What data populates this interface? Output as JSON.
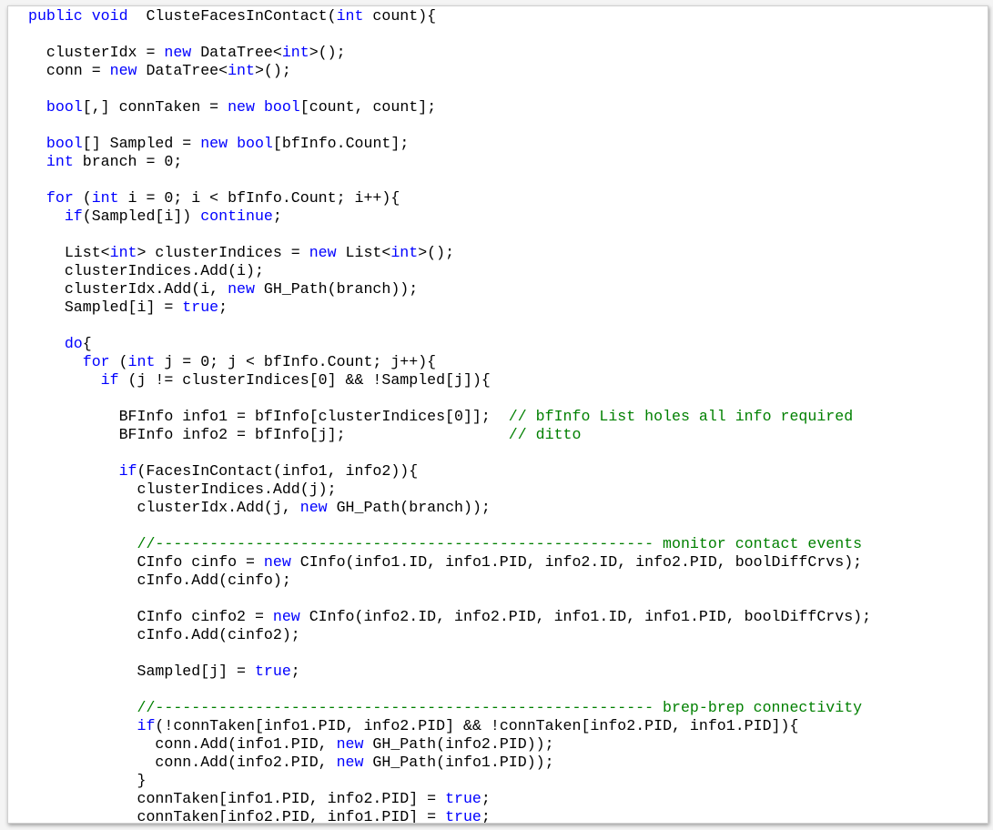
{
  "colors": {
    "keyword": "#0000ff",
    "comment": "#008000",
    "text": "#000000",
    "background": "#ffffff"
  },
  "code_lines": [
    [
      {
        "t": "public void",
        "c": "kw"
      },
      {
        "t": "  ClusteFacesInContact(",
        "c": "pl"
      },
      {
        "t": "int",
        "c": "kw"
      },
      {
        "t": " count){",
        "c": "pl"
      }
    ],
    [],
    [
      {
        "t": "  clusterIdx = ",
        "c": "pl"
      },
      {
        "t": "new",
        "c": "kw"
      },
      {
        "t": " DataTree<",
        "c": "pl"
      },
      {
        "t": "int",
        "c": "kw"
      },
      {
        "t": ">();",
        "c": "pl"
      }
    ],
    [
      {
        "t": "  conn = ",
        "c": "pl"
      },
      {
        "t": "new",
        "c": "kw"
      },
      {
        "t": " DataTree<",
        "c": "pl"
      },
      {
        "t": "int",
        "c": "kw"
      },
      {
        "t": ">();",
        "c": "pl"
      }
    ],
    [],
    [
      {
        "t": "  ",
        "c": "pl"
      },
      {
        "t": "bool",
        "c": "kw"
      },
      {
        "t": "[,] connTaken = ",
        "c": "pl"
      },
      {
        "t": "new",
        "c": "kw"
      },
      {
        "t": " ",
        "c": "pl"
      },
      {
        "t": "bool",
        "c": "kw"
      },
      {
        "t": "[count, count];",
        "c": "pl"
      }
    ],
    [],
    [
      {
        "t": "  ",
        "c": "pl"
      },
      {
        "t": "bool",
        "c": "kw"
      },
      {
        "t": "[] Sampled = ",
        "c": "pl"
      },
      {
        "t": "new",
        "c": "kw"
      },
      {
        "t": " ",
        "c": "pl"
      },
      {
        "t": "bool",
        "c": "kw"
      },
      {
        "t": "[bfInfo.Count];",
        "c": "pl"
      }
    ],
    [
      {
        "t": "  ",
        "c": "pl"
      },
      {
        "t": "int",
        "c": "kw"
      },
      {
        "t": " branch = 0;",
        "c": "pl"
      }
    ],
    [],
    [
      {
        "t": "  ",
        "c": "pl"
      },
      {
        "t": "for",
        "c": "kw"
      },
      {
        "t": " (",
        "c": "pl"
      },
      {
        "t": "int",
        "c": "kw"
      },
      {
        "t": " i = 0; i < bfInfo.Count; i++){",
        "c": "pl"
      }
    ],
    [
      {
        "t": "    ",
        "c": "pl"
      },
      {
        "t": "if",
        "c": "kw"
      },
      {
        "t": "(Sampled[i]) ",
        "c": "pl"
      },
      {
        "t": "continue",
        "c": "kw"
      },
      {
        "t": ";",
        "c": "pl"
      }
    ],
    [],
    [
      {
        "t": "    List<",
        "c": "pl"
      },
      {
        "t": "int",
        "c": "kw"
      },
      {
        "t": "> clusterIndices = ",
        "c": "pl"
      },
      {
        "t": "new",
        "c": "kw"
      },
      {
        "t": " List<",
        "c": "pl"
      },
      {
        "t": "int",
        "c": "kw"
      },
      {
        "t": ">();",
        "c": "pl"
      }
    ],
    [
      {
        "t": "    clusterIndices.Add(i);",
        "c": "pl"
      }
    ],
    [
      {
        "t": "    clusterIdx.Add(i, ",
        "c": "pl"
      },
      {
        "t": "new",
        "c": "kw"
      },
      {
        "t": " GH_Path(branch));",
        "c": "pl"
      }
    ],
    [
      {
        "t": "    Sampled[i] = ",
        "c": "pl"
      },
      {
        "t": "true",
        "c": "kw"
      },
      {
        "t": ";",
        "c": "pl"
      }
    ],
    [],
    [
      {
        "t": "    ",
        "c": "pl"
      },
      {
        "t": "do",
        "c": "kw"
      },
      {
        "t": "{",
        "c": "pl"
      }
    ],
    [
      {
        "t": "      ",
        "c": "pl"
      },
      {
        "t": "for",
        "c": "kw"
      },
      {
        "t": " (",
        "c": "pl"
      },
      {
        "t": "int",
        "c": "kw"
      },
      {
        "t": " j = 0; j < bfInfo.Count; j++){",
        "c": "pl"
      }
    ],
    [
      {
        "t": "        ",
        "c": "pl"
      },
      {
        "t": "if",
        "c": "kw"
      },
      {
        "t": " (j != clusterIndices[0] && !Sampled[j]){",
        "c": "pl"
      }
    ],
    [],
    [
      {
        "t": "          BFInfo info1 = bfInfo[clusterIndices[0]];  ",
        "c": "pl"
      },
      {
        "t": "// bfInfo List holes all info required",
        "c": "cm"
      }
    ],
    [
      {
        "t": "          BFInfo info2 = bfInfo[j];                  ",
        "c": "pl"
      },
      {
        "t": "// ditto",
        "c": "cm"
      }
    ],
    [],
    [
      {
        "t": "          ",
        "c": "pl"
      },
      {
        "t": "if",
        "c": "kw"
      },
      {
        "t": "(FacesInContact(info1, info2)){",
        "c": "pl"
      }
    ],
    [
      {
        "t": "            clusterIndices.Add(j);",
        "c": "pl"
      }
    ],
    [
      {
        "t": "            clusterIdx.Add(j, ",
        "c": "pl"
      },
      {
        "t": "new",
        "c": "kw"
      },
      {
        "t": " GH_Path(branch));",
        "c": "pl"
      }
    ],
    [],
    [
      {
        "t": "            ",
        "c": "pl"
      },
      {
        "t": "//------------------------------------------------------- monitor contact events",
        "c": "cm"
      }
    ],
    [
      {
        "t": "            CInfo cinfo = ",
        "c": "pl"
      },
      {
        "t": "new",
        "c": "kw"
      },
      {
        "t": " CInfo(info1.ID, info1.PID, info2.ID, info2.PID, boolDiffCrvs);",
        "c": "pl"
      }
    ],
    [
      {
        "t": "            cInfo.Add(cinfo);",
        "c": "pl"
      }
    ],
    [],
    [
      {
        "t": "            CInfo cinfo2 = ",
        "c": "pl"
      },
      {
        "t": "new",
        "c": "kw"
      },
      {
        "t": " CInfo(info2.ID, info2.PID, info1.ID, info1.PID, boolDiffCrvs);",
        "c": "pl"
      }
    ],
    [
      {
        "t": "            cInfo.Add(cinfo2);",
        "c": "pl"
      }
    ],
    [],
    [
      {
        "t": "            Sampled[j] = ",
        "c": "pl"
      },
      {
        "t": "true",
        "c": "kw"
      },
      {
        "t": ";",
        "c": "pl"
      }
    ],
    [],
    [
      {
        "t": "            ",
        "c": "pl"
      },
      {
        "t": "//------------------------------------------------------- brep-brep connectivity",
        "c": "cm"
      }
    ],
    [
      {
        "t": "            ",
        "c": "pl"
      },
      {
        "t": "if",
        "c": "kw"
      },
      {
        "t": "(!connTaken[info1.PID, info2.PID] && !connTaken[info2.PID, info1.PID]){",
        "c": "pl"
      }
    ],
    [
      {
        "t": "              conn.Add(info1.PID, ",
        "c": "pl"
      },
      {
        "t": "new",
        "c": "kw"
      },
      {
        "t": " GH_Path(info2.PID));",
        "c": "pl"
      }
    ],
    [
      {
        "t": "              conn.Add(info2.PID, ",
        "c": "pl"
      },
      {
        "t": "new",
        "c": "kw"
      },
      {
        "t": " GH_Path(info1.PID));",
        "c": "pl"
      }
    ],
    [
      {
        "t": "            }",
        "c": "pl"
      }
    ],
    [
      {
        "t": "            connTaken[info1.PID, info2.PID] = ",
        "c": "pl"
      },
      {
        "t": "true",
        "c": "kw"
      },
      {
        "t": ";",
        "c": "pl"
      }
    ],
    [
      {
        "t": "            connTaken[info2.PID, info1.PID] = ",
        "c": "pl"
      },
      {
        "t": "true",
        "c": "kw"
      },
      {
        "t": ";",
        "c": "pl"
      }
    ]
  ]
}
